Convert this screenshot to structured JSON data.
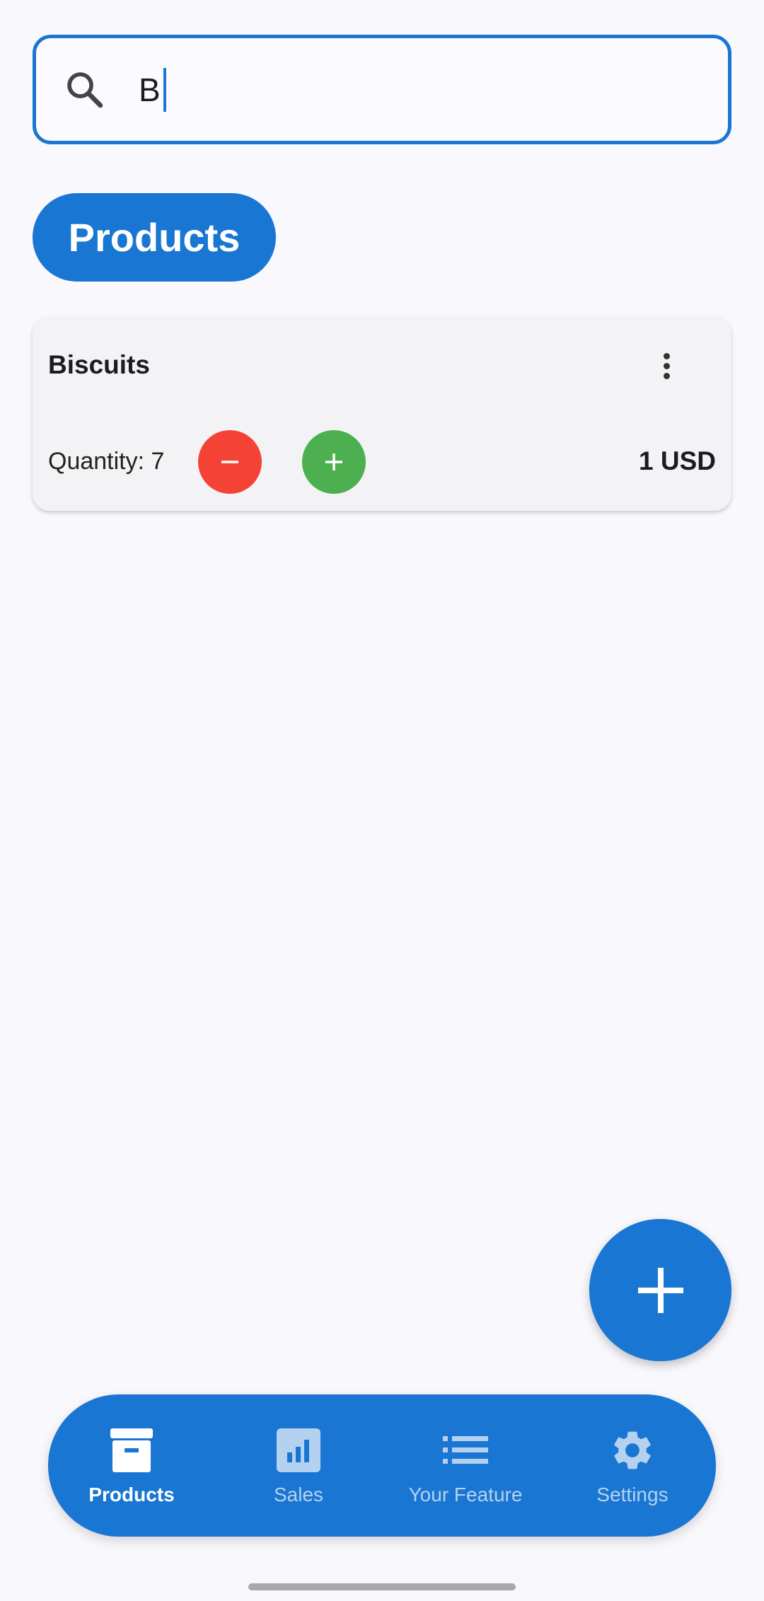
{
  "search": {
    "value": "B"
  },
  "filter_chip": {
    "label": "Products"
  },
  "products": [
    {
      "name": "Biscuits",
      "quantity_label": "Quantity: 7",
      "price": "1 USD"
    }
  ],
  "fab": {
    "icon": "add-icon"
  },
  "bottom_nav": {
    "items": [
      {
        "label": "Products",
        "icon": "inventory-box-icon",
        "active": true
      },
      {
        "label": "Sales",
        "icon": "bar-chart-icon",
        "active": false
      },
      {
        "label": "Your Feature",
        "icon": "list-icon",
        "active": false
      },
      {
        "label": "Settings",
        "icon": "gear-icon",
        "active": false
      }
    ]
  },
  "colors": {
    "primary": "#1976d2",
    "decrement": "#f44336",
    "increment": "#4caf50",
    "background": "#f8f8fd"
  }
}
